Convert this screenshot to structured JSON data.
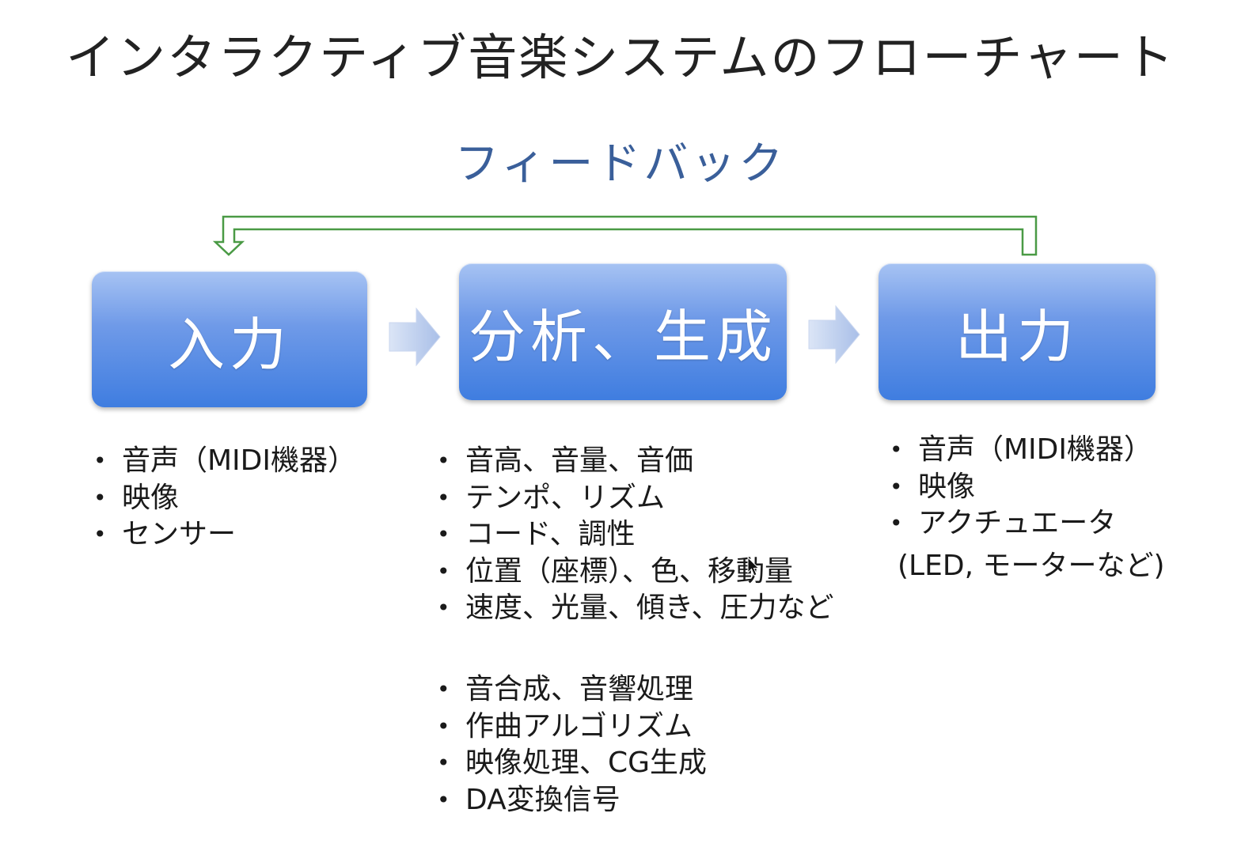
{
  "title": "インタラクティブ音楽システムのフローチャート",
  "feedback": {
    "label": "フィードバック",
    "color": "#4a9a45"
  },
  "boxes": {
    "input": "入力",
    "process": "分析、生成",
    "output": "出力",
    "gradient_top": "#a7c3f3",
    "gradient_bottom": "#3f7de0"
  },
  "lists": {
    "input": [
      "音声（MIDI機器）",
      "映像",
      "センサー"
    ],
    "analysis": [
      "音高、音量、音価",
      "テンポ、リズム",
      "コード、調性",
      "位置（座標）、色、移動量",
      "速度、光量、傾き、圧力など"
    ],
    "generation": [
      "音合成、音響処理",
      "作曲アルゴリズム",
      "映像処理、CG生成",
      "DA変換信号"
    ],
    "output": [
      "音声（MIDI機器）",
      "映像",
      "アクチュエータ"
    ],
    "output_note": "(LED, モーターなど)"
  }
}
